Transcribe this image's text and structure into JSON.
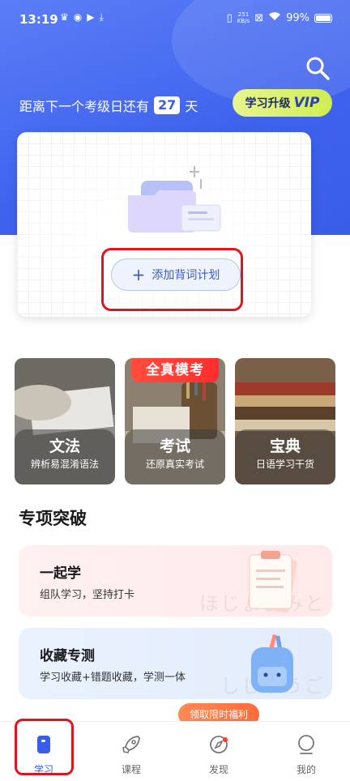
{
  "status_bar": {
    "time": "13:19",
    "speed_value": "251",
    "speed_unit": "KB/s",
    "battery": "99%"
  },
  "header": {
    "countdown_prefix": "距离下一个考级日还有",
    "countdown_days": "27",
    "countdown_suffix": "天",
    "vip_label": "学习升级",
    "vip_badge": "VIP"
  },
  "plan_card": {
    "add_button_label": "添加背词计划"
  },
  "categories": [
    {
      "title": "文法",
      "subtitle": "辨析易混淆语法"
    },
    {
      "title": "考试",
      "subtitle": "还原真实考试",
      "ribbon": "全真模考"
    },
    {
      "title": "宝典",
      "subtitle": "日语学习干货"
    }
  ],
  "section": {
    "title": "专项突破"
  },
  "features": [
    {
      "title": "一起学",
      "subtitle": "组队学习，坚持打卡",
      "watermark": "ほじょよみと"
    },
    {
      "title": "收藏专测",
      "subtitle": "学习收藏+错题收藏，学测一体",
      "watermark": "しじゅうご"
    }
  ],
  "promo": {
    "label": "领取限时福利"
  },
  "bottom_nav": [
    {
      "label": "学习",
      "icon": "study-icon"
    },
    {
      "label": "课程",
      "icon": "rocket-icon"
    },
    {
      "label": "发现",
      "icon": "compass-icon"
    },
    {
      "label": "我的",
      "icon": "profile-icon"
    }
  ],
  "colors": {
    "primary": "#3a5cea",
    "vip_green": "#cfee52",
    "highlight_red": "#e0141e",
    "promo_orange": "#ff6c3a"
  }
}
